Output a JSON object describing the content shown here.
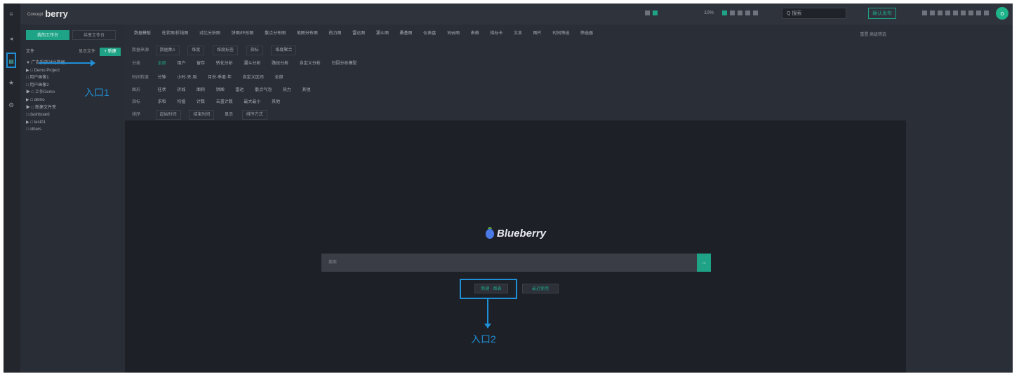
{
  "app": {
    "brand_prefix": "Concept",
    "brand_name": "berry",
    "header_search_placeholder": "Q 搜索",
    "header_zoom": "10%",
    "header_button": "确认发布",
    "avatar_letter": "o"
  },
  "sidebar": {
    "tabs": [
      {
        "label": "我的工作台"
      },
      {
        "label": "共享工作台"
      }
    ],
    "header_label": "文件",
    "header_mid": "显示文件",
    "new_button": "+ 新建",
    "tree_items": [
      "▼ 广告投放对比数据",
      "▶ □ Demo Project",
      "  □ 用户画像1",
      "  □ 用户画像2",
      "▶ □ 工作Demo",
      "▶ □ demo",
      "▶ □ 新建文件夹",
      "  □ dashboard",
      "▶ □ test01",
      "  □ others"
    ],
    "entry1_label": "入口1"
  },
  "main": {
    "toolbar_items": [
      "数据模板",
      "柱状图/折线图",
      "对比分析图",
      "饼图/环形图",
      "散点分布图",
      "地图分布图",
      "热力图",
      "雷达图",
      "漏斗图",
      "桑基图",
      "仪表盘",
      "词云图",
      "表格",
      "指标卡",
      "文本",
      "图片",
      "时间筛选",
      "筛选器"
    ],
    "reset_label": "重置 高级筛选",
    "filter_rows": [
      {
        "key": "数据来源",
        "values": [
          "数据集A",
          "维度",
          "维度标签",
          "指标",
          "维度聚合"
        ]
      },
      {
        "key": "分类",
        "values": [
          "全部",
          "用户",
          "留存",
          "转化分析",
          "漏斗分析",
          "路径分析",
          "自定义分析",
          "归因分析模型"
        ]
      },
      {
        "key": "时间粒度",
        "values": [
          "分钟",
          "小时·天·周",
          "月份·季度·年",
          "自定义区间",
          "全部"
        ]
      },
      {
        "key": "图形",
        "values": [
          "柱状",
          "折线",
          "面积",
          "饼图",
          "雷达",
          "散点气泡",
          "热力",
          "其他"
        ]
      },
      {
        "key": "指标",
        "values": [
          "求和",
          "均值",
          "计数",
          "去重计数",
          "最大最小",
          "其他"
        ]
      },
      {
        "key": "排序",
        "values": [
          "起始时间",
          "结束时间",
          "显示",
          "排序方式"
        ]
      }
    ],
    "selected_category": "全部",
    "search_placeholder": "搜索",
    "search_go": "→",
    "entry_button": "新建 · 图表",
    "entry_button2": "最近使用",
    "entry2_label": "入口2",
    "logo_text": "Blueberry"
  }
}
